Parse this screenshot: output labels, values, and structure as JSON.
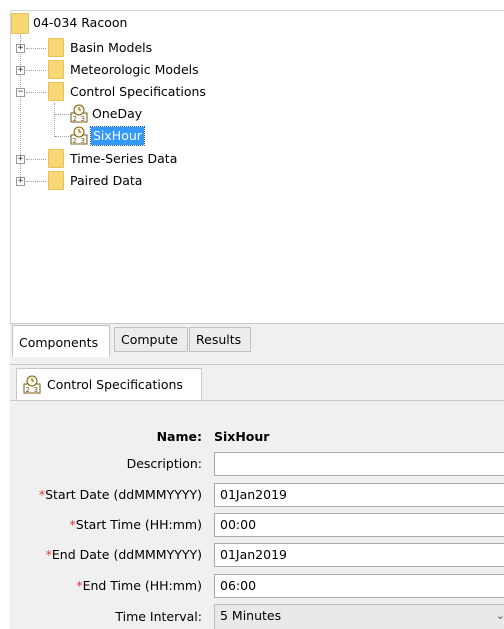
{
  "tree": {
    "root": "04-034 Racoon",
    "basin_models": "Basin Models",
    "meteorologic_models": "Meteorologic Models",
    "control_specifications": "Control Specifications",
    "one_day": "OneDay",
    "six_hour": "SixHour",
    "time_series": "Time-Series Data",
    "paired_data": "Paired Data"
  },
  "tabs": {
    "components": "Components",
    "compute": "Compute",
    "results": "Results"
  },
  "editor": {
    "tab_label": "Control Specifications",
    "name_label": "Name:",
    "name_value": "SixHour",
    "description_label": "Description:",
    "description_value": "",
    "start_date_label": "Start Date (ddMMMYYYY)",
    "start_date_value": "01Jan2019",
    "start_time_label": "Start Time (HH:mm)",
    "start_time_value": "00:00",
    "end_date_label": "End Date (ddMMMYYYY)",
    "end_date_value": "01Jan2019",
    "end_time_label": "End Time (HH:mm)",
    "end_time_value": "06:00",
    "time_interval_label": "Time Interval:",
    "time_interval_value": "5 Minutes",
    "required_marker": "*",
    "label_suffix": ":"
  },
  "icons": {
    "expand": "plus",
    "collapse": "minus",
    "folder": "folder-icon",
    "control_spec": "control-spec-icon",
    "dropdown": "chevron-down-icon"
  },
  "colors": {
    "folder": "#f8d775",
    "selection": "#3399ff",
    "required": "#e23b3b",
    "panel": "#f0f0f0"
  }
}
